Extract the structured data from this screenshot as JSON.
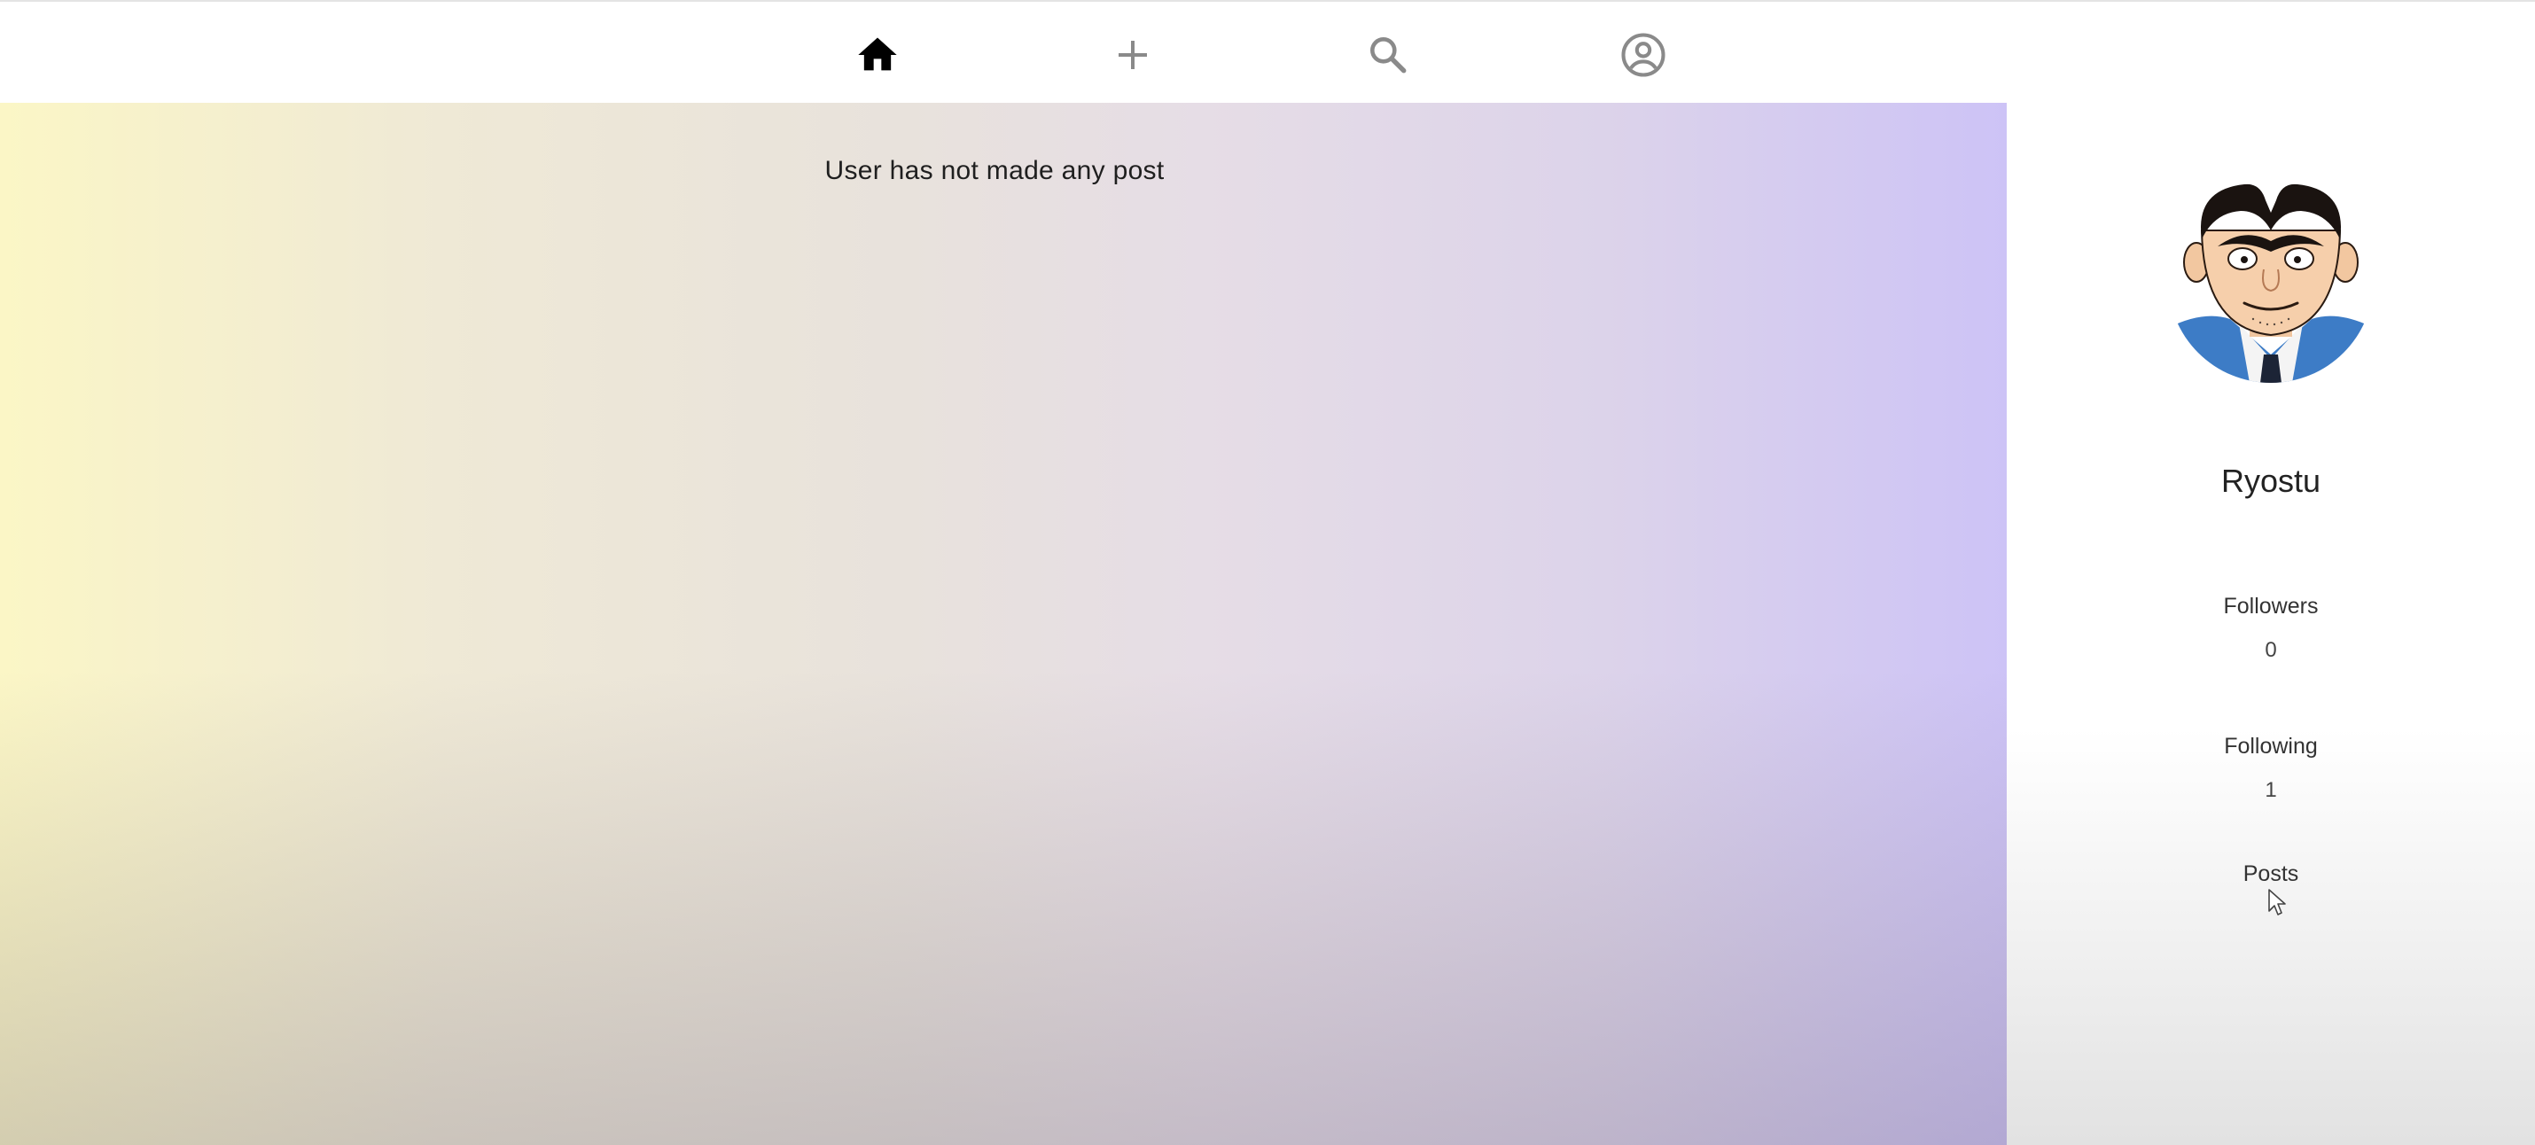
{
  "nav": {
    "items": [
      {
        "name": "home",
        "icon": "home-icon",
        "active": true
      },
      {
        "name": "add",
        "icon": "plus-icon",
        "active": false
      },
      {
        "name": "search",
        "icon": "search-icon",
        "active": false
      },
      {
        "name": "profile",
        "icon": "account-circle-icon",
        "active": false
      }
    ],
    "active_color": "#000000",
    "inactive_color": "#8a8a8a"
  },
  "feed": {
    "empty_message": "User has not made any post"
  },
  "profile": {
    "name": "Ryostu",
    "followers_label": "Followers",
    "followers_value": "0",
    "following_label": "Following",
    "following_value": "1",
    "posts_label": "Posts"
  }
}
